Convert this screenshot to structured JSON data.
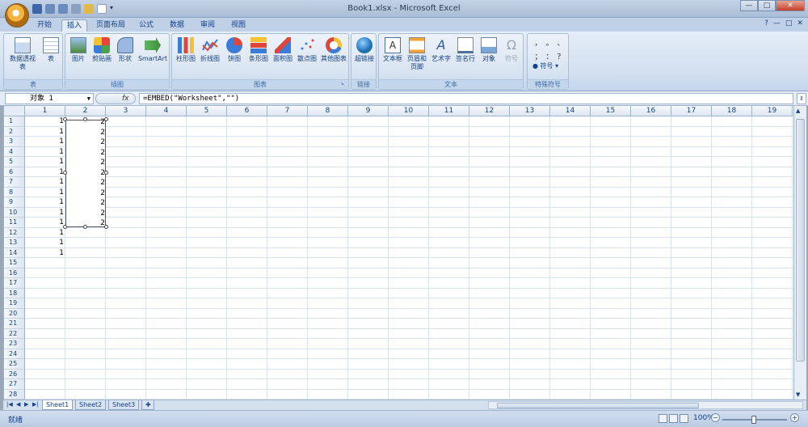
{
  "window": {
    "title": "Book1.xlsx - Microsoft Excel"
  },
  "titlebar": {
    "minimize": "—",
    "maximize": "□",
    "close": "✕"
  },
  "tabs": [
    "开始",
    "插入",
    "页面布局",
    "公式",
    "数据",
    "审阅",
    "视图"
  ],
  "active_tab": "插入",
  "ribbon": {
    "groups": [
      {
        "label": "表",
        "buttons": [
          "数据透视表",
          "表"
        ]
      },
      {
        "label": "插图",
        "buttons": [
          "图片",
          "剪贴画",
          "形状",
          "SmartArt"
        ]
      },
      {
        "label": "图表",
        "buttons": [
          "柱形图",
          "折线图",
          "饼图",
          "条形图",
          "面积图",
          "散点图",
          "其他图表"
        ]
      },
      {
        "label": "链接",
        "buttons": [
          "超链接"
        ]
      },
      {
        "label": "文本",
        "buttons": [
          "文本框",
          "页眉和页脚",
          "艺术字",
          "签名行",
          "对象",
          "符号"
        ]
      },
      {
        "label": "特殊符号",
        "buttons": [
          "符号"
        ]
      }
    ],
    "special_symbols": [
      "，",
      "。",
      "、",
      "；",
      "：",
      "？"
    ]
  },
  "formula_bar": {
    "name_box": "对象 1",
    "fx": "fx",
    "formula": "=EMBED(\"Worksheet\",\"\")"
  },
  "grid": {
    "columns": [
      "1",
      "2",
      "3",
      "4",
      "5",
      "6",
      "7",
      "8",
      "9",
      "10",
      "11",
      "12",
      "13",
      "14",
      "15",
      "16",
      "17",
      "18",
      "19"
    ],
    "rows": [
      "1",
      "2",
      "3",
      "4",
      "5",
      "6",
      "7",
      "8",
      "9",
      "10",
      "11",
      "12",
      "13",
      "14",
      "15",
      "16",
      "17",
      "18",
      "19",
      "20",
      "21",
      "22",
      "23",
      "24",
      "25",
      "26",
      "27",
      "28"
    ],
    "col1_values": [
      "1",
      "1",
      "1",
      "1",
      "1",
      "1",
      "1",
      "1",
      "1",
      "1",
      "1",
      "1",
      "1",
      "1"
    ],
    "col2_values": [
      "2",
      "2",
      "2",
      "2",
      "2",
      "2",
      "2",
      "2",
      "2",
      "2",
      "2"
    ]
  },
  "sheets": [
    "Sheet1",
    "Sheet2",
    "Sheet3"
  ],
  "active_sheet": "Sheet1",
  "status": {
    "ready": "就绪",
    "zoom": "100%"
  }
}
